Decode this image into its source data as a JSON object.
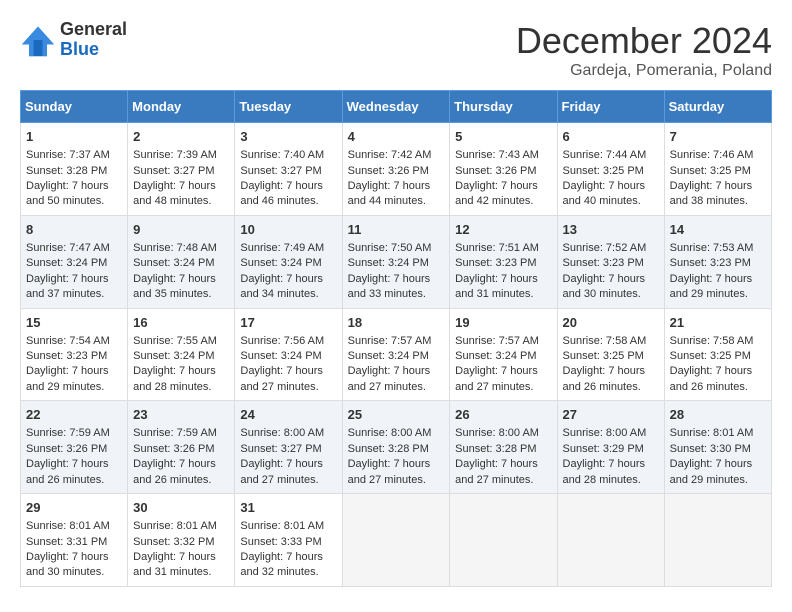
{
  "header": {
    "logo_general": "General",
    "logo_blue": "Blue",
    "month_title": "December 2024",
    "location": "Gardeja, Pomerania, Poland"
  },
  "days_of_week": [
    "Sunday",
    "Monday",
    "Tuesday",
    "Wednesday",
    "Thursday",
    "Friday",
    "Saturday"
  ],
  "weeks": [
    [
      {
        "day": "1",
        "sunrise": "Sunrise: 7:37 AM",
        "sunset": "Sunset: 3:28 PM",
        "daylight": "Daylight: 7 hours and 50 minutes."
      },
      {
        "day": "2",
        "sunrise": "Sunrise: 7:39 AM",
        "sunset": "Sunset: 3:27 PM",
        "daylight": "Daylight: 7 hours and 48 minutes."
      },
      {
        "day": "3",
        "sunrise": "Sunrise: 7:40 AM",
        "sunset": "Sunset: 3:27 PM",
        "daylight": "Daylight: 7 hours and 46 minutes."
      },
      {
        "day": "4",
        "sunrise": "Sunrise: 7:42 AM",
        "sunset": "Sunset: 3:26 PM",
        "daylight": "Daylight: 7 hours and 44 minutes."
      },
      {
        "day": "5",
        "sunrise": "Sunrise: 7:43 AM",
        "sunset": "Sunset: 3:26 PM",
        "daylight": "Daylight: 7 hours and 42 minutes."
      },
      {
        "day": "6",
        "sunrise": "Sunrise: 7:44 AM",
        "sunset": "Sunset: 3:25 PM",
        "daylight": "Daylight: 7 hours and 40 minutes."
      },
      {
        "day": "7",
        "sunrise": "Sunrise: 7:46 AM",
        "sunset": "Sunset: 3:25 PM",
        "daylight": "Daylight: 7 hours and 38 minutes."
      }
    ],
    [
      {
        "day": "8",
        "sunrise": "Sunrise: 7:47 AM",
        "sunset": "Sunset: 3:24 PM",
        "daylight": "Daylight: 7 hours and 37 minutes."
      },
      {
        "day": "9",
        "sunrise": "Sunrise: 7:48 AM",
        "sunset": "Sunset: 3:24 PM",
        "daylight": "Daylight: 7 hours and 35 minutes."
      },
      {
        "day": "10",
        "sunrise": "Sunrise: 7:49 AM",
        "sunset": "Sunset: 3:24 PM",
        "daylight": "Daylight: 7 hours and 34 minutes."
      },
      {
        "day": "11",
        "sunrise": "Sunrise: 7:50 AM",
        "sunset": "Sunset: 3:24 PM",
        "daylight": "Daylight: 7 hours and 33 minutes."
      },
      {
        "day": "12",
        "sunrise": "Sunrise: 7:51 AM",
        "sunset": "Sunset: 3:23 PM",
        "daylight": "Daylight: 7 hours and 31 minutes."
      },
      {
        "day": "13",
        "sunrise": "Sunrise: 7:52 AM",
        "sunset": "Sunset: 3:23 PM",
        "daylight": "Daylight: 7 hours and 30 minutes."
      },
      {
        "day": "14",
        "sunrise": "Sunrise: 7:53 AM",
        "sunset": "Sunset: 3:23 PM",
        "daylight": "Daylight: 7 hours and 29 minutes."
      }
    ],
    [
      {
        "day": "15",
        "sunrise": "Sunrise: 7:54 AM",
        "sunset": "Sunset: 3:23 PM",
        "daylight": "Daylight: 7 hours and 29 minutes."
      },
      {
        "day": "16",
        "sunrise": "Sunrise: 7:55 AM",
        "sunset": "Sunset: 3:24 PM",
        "daylight": "Daylight: 7 hours and 28 minutes."
      },
      {
        "day": "17",
        "sunrise": "Sunrise: 7:56 AM",
        "sunset": "Sunset: 3:24 PM",
        "daylight": "Daylight: 7 hours and 27 minutes."
      },
      {
        "day": "18",
        "sunrise": "Sunrise: 7:57 AM",
        "sunset": "Sunset: 3:24 PM",
        "daylight": "Daylight: 7 hours and 27 minutes."
      },
      {
        "day": "19",
        "sunrise": "Sunrise: 7:57 AM",
        "sunset": "Sunset: 3:24 PM",
        "daylight": "Daylight: 7 hours and 27 minutes."
      },
      {
        "day": "20",
        "sunrise": "Sunrise: 7:58 AM",
        "sunset": "Sunset: 3:25 PM",
        "daylight": "Daylight: 7 hours and 26 minutes."
      },
      {
        "day": "21",
        "sunrise": "Sunrise: 7:58 AM",
        "sunset": "Sunset: 3:25 PM",
        "daylight": "Daylight: 7 hours and 26 minutes."
      }
    ],
    [
      {
        "day": "22",
        "sunrise": "Sunrise: 7:59 AM",
        "sunset": "Sunset: 3:26 PM",
        "daylight": "Daylight: 7 hours and 26 minutes."
      },
      {
        "day": "23",
        "sunrise": "Sunrise: 7:59 AM",
        "sunset": "Sunset: 3:26 PM",
        "daylight": "Daylight: 7 hours and 26 minutes."
      },
      {
        "day": "24",
        "sunrise": "Sunrise: 8:00 AM",
        "sunset": "Sunset: 3:27 PM",
        "daylight": "Daylight: 7 hours and 27 minutes."
      },
      {
        "day": "25",
        "sunrise": "Sunrise: 8:00 AM",
        "sunset": "Sunset: 3:28 PM",
        "daylight": "Daylight: 7 hours and 27 minutes."
      },
      {
        "day": "26",
        "sunrise": "Sunrise: 8:00 AM",
        "sunset": "Sunset: 3:28 PM",
        "daylight": "Daylight: 7 hours and 27 minutes."
      },
      {
        "day": "27",
        "sunrise": "Sunrise: 8:00 AM",
        "sunset": "Sunset: 3:29 PM",
        "daylight": "Daylight: 7 hours and 28 minutes."
      },
      {
        "day": "28",
        "sunrise": "Sunrise: 8:01 AM",
        "sunset": "Sunset: 3:30 PM",
        "daylight": "Daylight: 7 hours and 29 minutes."
      }
    ],
    [
      {
        "day": "29",
        "sunrise": "Sunrise: 8:01 AM",
        "sunset": "Sunset: 3:31 PM",
        "daylight": "Daylight: 7 hours and 30 minutes."
      },
      {
        "day": "30",
        "sunrise": "Sunrise: 8:01 AM",
        "sunset": "Sunset: 3:32 PM",
        "daylight": "Daylight: 7 hours and 31 minutes."
      },
      {
        "day": "31",
        "sunrise": "Sunrise: 8:01 AM",
        "sunset": "Sunset: 3:33 PM",
        "daylight": "Daylight: 7 hours and 32 minutes."
      },
      null,
      null,
      null,
      null
    ]
  ]
}
